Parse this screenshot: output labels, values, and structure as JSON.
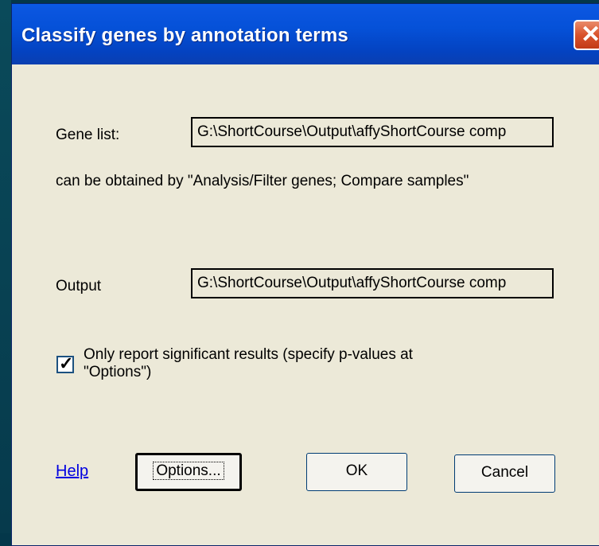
{
  "window": {
    "title": "Classify genes by annotation terms"
  },
  "gene_list": {
    "label": "Gene list:",
    "value": "G:\\ShortCourse\\Output\\affyShortCourse comp",
    "hint": "can be obtained by \"Analysis/Filter genes; Compare samples\""
  },
  "output": {
    "label": "Output",
    "value": "G:\\ShortCourse\\Output\\affyShortCourse comp"
  },
  "significant": {
    "checked": true,
    "label_line1": "Only report significant results (specify p-values at",
    "label_line2": "\"Options\")"
  },
  "buttons": {
    "help": "Help",
    "options": "Options...",
    "ok": "OK",
    "cancel": "Cancel"
  },
  "colors": {
    "titlebar": "#0551d8",
    "dialog_bg": "#ece9d8",
    "close": "#d9532c"
  }
}
